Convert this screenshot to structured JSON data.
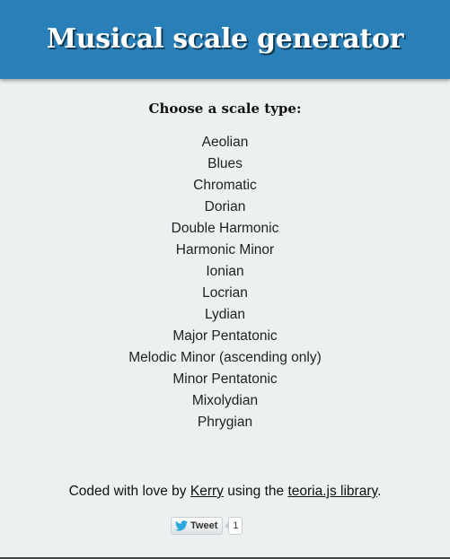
{
  "header": {
    "title": "Musical scale generator",
    "color": "#2980b9"
  },
  "prompt": "Choose a scale type:",
  "scales": [
    "Aeolian",
    "Blues",
    "Chromatic",
    "Dorian",
    "Double Harmonic",
    "Harmonic Minor",
    "Ionian",
    "Locrian",
    "Lydian",
    "Major Pentatonic",
    "Melodic Minor (ascending only)",
    "Minor Pentatonic",
    "Mixolydian",
    "Phrygian"
  ],
  "footer": {
    "prefix": "Coded with love by ",
    "author_link": "Kerry",
    "middle": " using the ",
    "library_link": "teoria.js library",
    "suffix": "."
  },
  "tweet": {
    "label": "Tweet",
    "count": "1",
    "icon": "twitter-bird-icon"
  },
  "colors": {
    "background": "#ecf0f1",
    "tweet_blue": "#2aa9e0"
  }
}
